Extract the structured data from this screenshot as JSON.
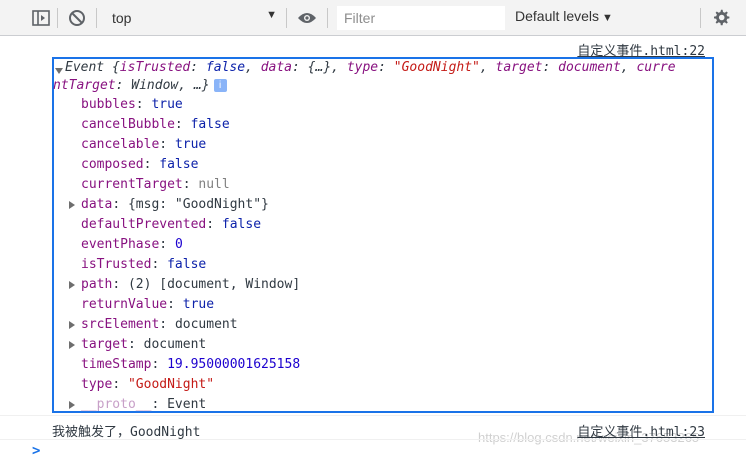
{
  "toolbar": {
    "context": "top",
    "filter_placeholder": "Filter",
    "levels_label": "Default levels"
  },
  "messages": [
    {
      "source": "自定义事件.html:22",
      "summary": {
        "prefix": "Event {",
        "is_trusted_key": "isTrusted",
        "is_trusted_val": "false",
        "data_key": "data",
        "data_val": "{…}",
        "type_key": "type",
        "type_val": "\"GoodNight\"",
        "target_key": "target",
        "target_val": "document",
        "current_target_key_part1": "curre",
        "current_target_key_part2": "ntTarget",
        "current_target_val": "Window",
        "suffix": "…}"
      },
      "properties": [
        {
          "key": "bubbles",
          "value": "true",
          "kind": "bool",
          "expandable": false
        },
        {
          "key": "cancelBubble",
          "value": "false",
          "kind": "bool",
          "expandable": false
        },
        {
          "key": "cancelable",
          "value": "true",
          "kind": "bool",
          "expandable": false
        },
        {
          "key": "composed",
          "value": "false",
          "kind": "bool",
          "expandable": false
        },
        {
          "key": "currentTarget",
          "value": "null",
          "kind": "null",
          "expandable": false
        },
        {
          "key": "data",
          "value": "{msg: \"GoodNight\"}",
          "kind": "obj",
          "expandable": true
        },
        {
          "key": "defaultPrevented",
          "value": "false",
          "kind": "bool",
          "expandable": false
        },
        {
          "key": "eventPhase",
          "value": "0",
          "kind": "num",
          "expandable": false
        },
        {
          "key": "isTrusted",
          "value": "false",
          "kind": "bool",
          "expandable": false
        },
        {
          "key": "path",
          "value": "(2) [document, Window]",
          "kind": "obj",
          "expandable": true
        },
        {
          "key": "returnValue",
          "value": "true",
          "kind": "bool",
          "expandable": false
        },
        {
          "key": "srcElement",
          "value": "document",
          "kind": "obj",
          "expandable": true
        },
        {
          "key": "target",
          "value": "document",
          "kind": "obj",
          "expandable": true
        },
        {
          "key": "timeStamp",
          "value": "19.95000001625158",
          "kind": "num",
          "expandable": false
        },
        {
          "key": "type",
          "value": "\"GoodNight\"",
          "kind": "str",
          "expandable": false
        },
        {
          "key": "__proto__",
          "value": "Event",
          "kind": "obj",
          "expandable": true
        }
      ]
    },
    {
      "source": "自定义事件.html:23",
      "text": "我被触发了，GoodNight"
    }
  ],
  "watermark": "https://blog.csdn.net/weixin_37653265",
  "prompt_symbol": ">",
  "colors": {
    "highlight_border": "#1a73e8",
    "keyword": "#881280",
    "string": "#c41a16",
    "number": "#1c00cf",
    "boolean": "#0d22aa"
  }
}
